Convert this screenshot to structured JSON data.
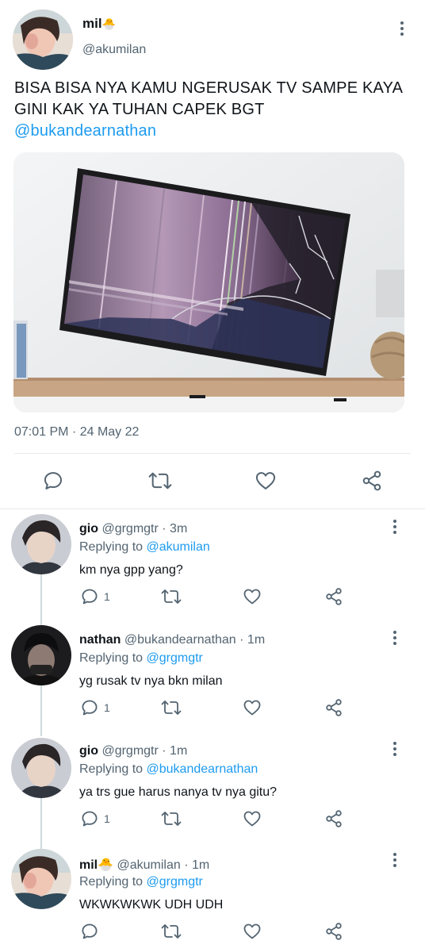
{
  "tweet": {
    "name": "mil",
    "name_emoji": "🐣",
    "handle": "@akumilan",
    "text": "BISA BISA NYA KAMU NGERUSAK TV SAMPE KAYA GINI KAK YA TUHAN CAPEK BGT ",
    "mention": "@bukandearnathan",
    "timestamp": "07:01 PM · 24 May 22"
  },
  "replies": [
    {
      "name": "gio",
      "handle": "@grgmgtr",
      "time": "3m",
      "replying_label": "Replying to ",
      "replying_to": "@akumilan",
      "text": "km nya gpp yang?",
      "reply_count": "1"
    },
    {
      "name": "nathan",
      "handle": "@bukandearnathan",
      "time": "1m",
      "replying_label": "Replying to ",
      "replying_to": "@grgmgtr",
      "text": "yg rusak tv nya bkn milan",
      "reply_count": "1"
    },
    {
      "name": "gio",
      "handle": "@grgmgtr",
      "time": "1m",
      "replying_label": "Replying to ",
      "replying_to": "@bukandearnathan",
      "text": "ya trs gue harus nanya tv nya gitu?",
      "reply_count": "1"
    },
    {
      "name": "mil🐣",
      "handle": "@akumilan",
      "time": "1m",
      "replying_label": "Replying to ",
      "replying_to": "@grgmgtr",
      "text": "WKWKWKWK UDH UDH",
      "reply_count": ""
    }
  ],
  "separator": " · ",
  "colors": {
    "accent": "#1d9bf0",
    "muted": "#536471",
    "text": "#0f1419"
  }
}
